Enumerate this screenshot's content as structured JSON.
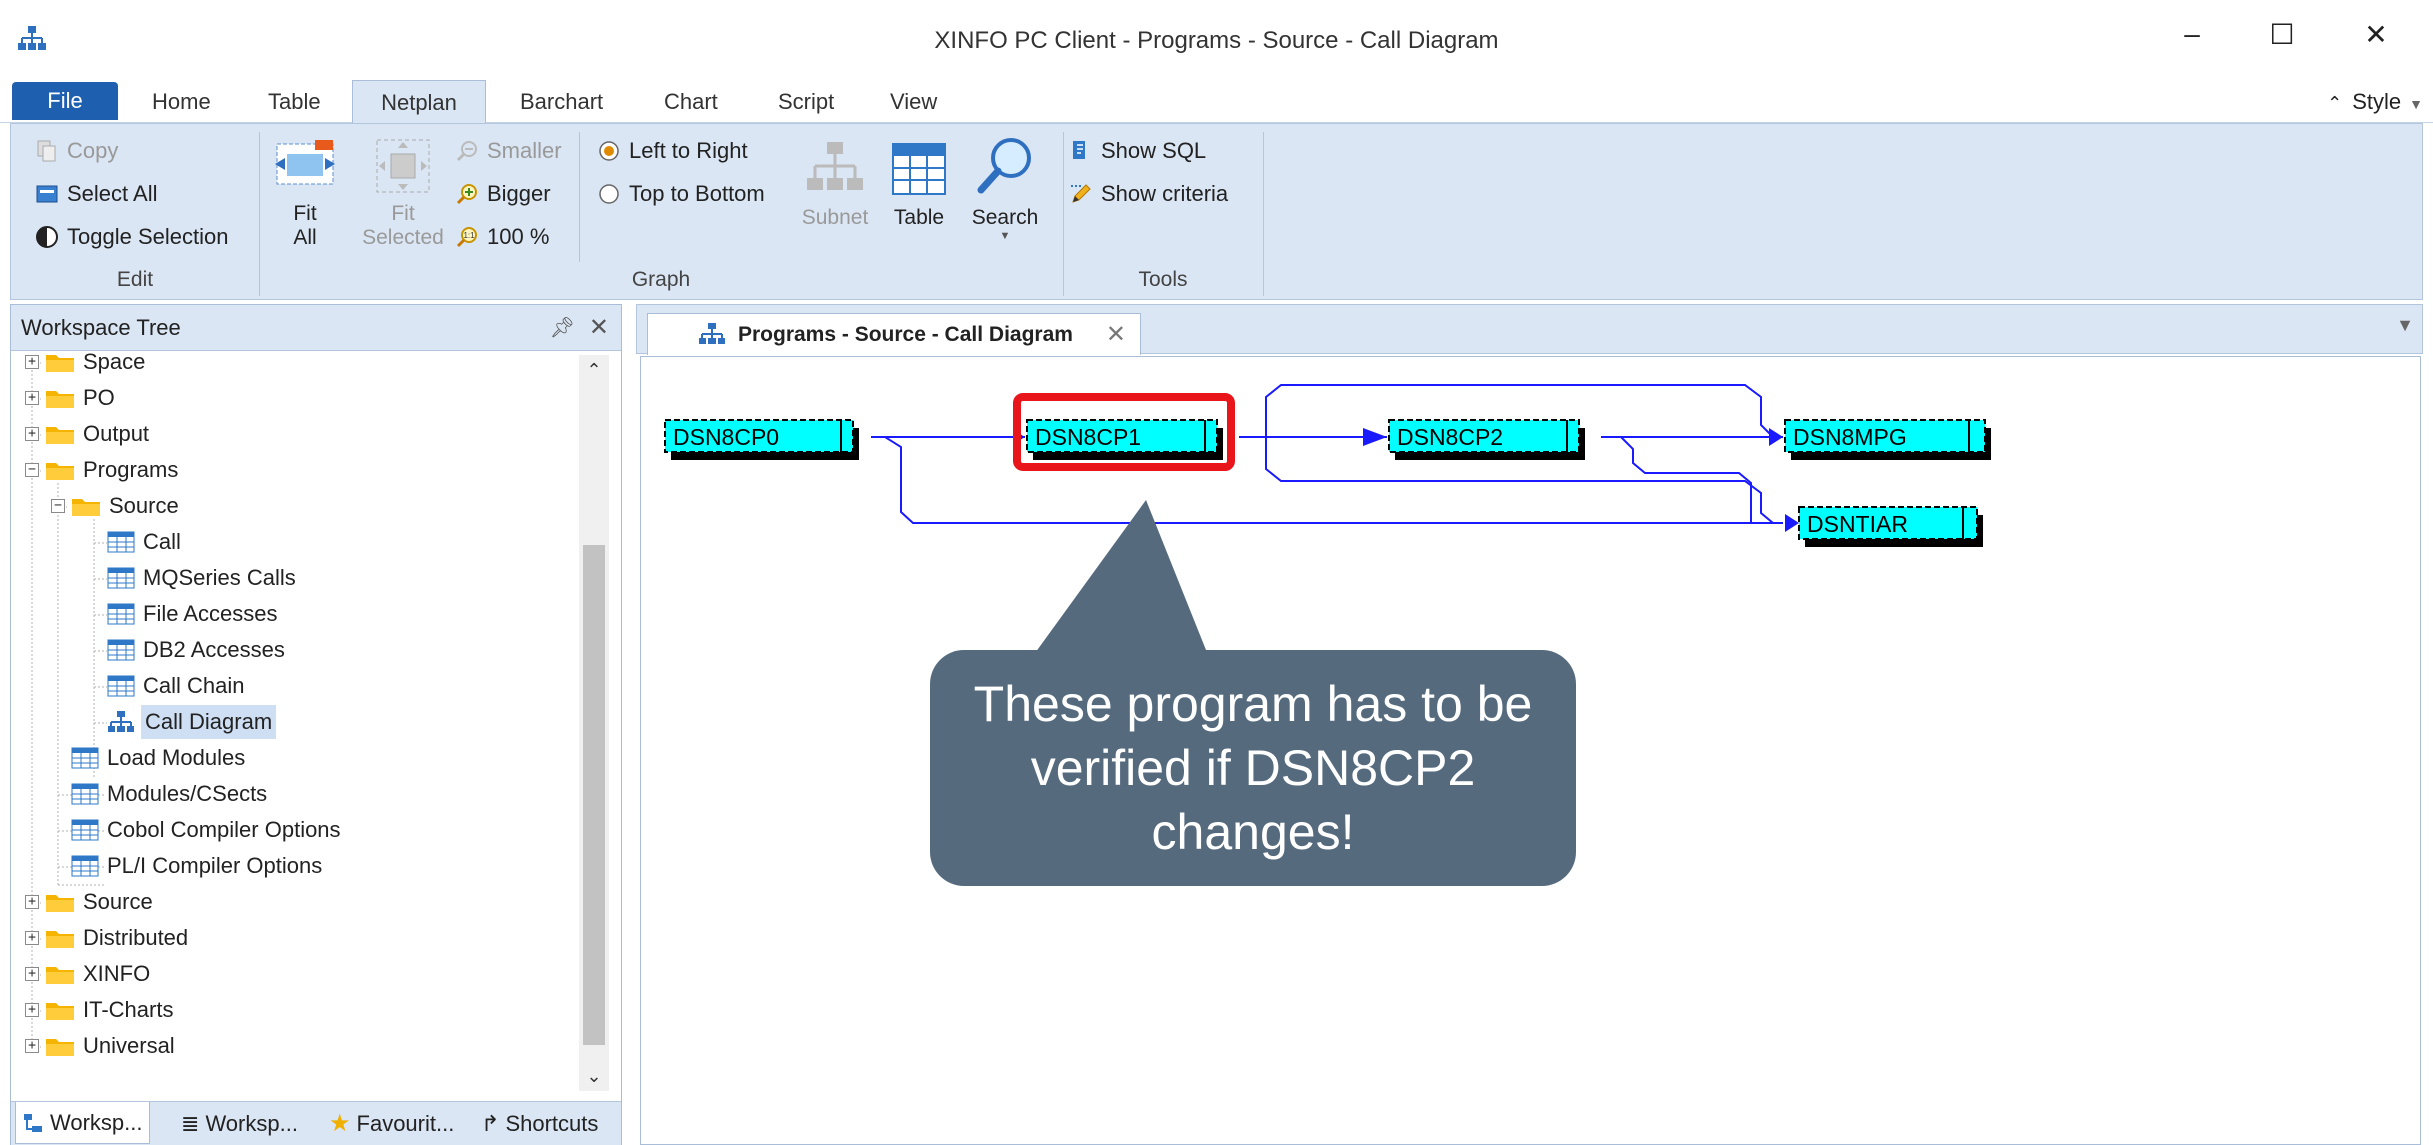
{
  "window": {
    "title": "XINFO PC Client - Programs - Source - Call Diagram",
    "minimize": "–",
    "maximize": "☐",
    "close": "✕"
  },
  "ribbon_tabs": [
    "File",
    "Home",
    "Table",
    "Netplan",
    "Barchart",
    "Chart",
    "Script",
    "View"
  ],
  "ribbon_active_tab": "Netplan",
  "style_label": "Style",
  "ribbon": {
    "edit": {
      "copy": "Copy",
      "select_all": "Select All",
      "toggle_selection": "Toggle Selection",
      "label": "Edit"
    },
    "graph": {
      "fit_all_1": "Fit",
      "fit_all_2": "All",
      "fit_selected_1": "Fit",
      "fit_selected_2": "Selected",
      "smaller": "Smaller",
      "bigger": "Bigger",
      "zoom": "100 %",
      "left_to_right": "Left to Right",
      "top_to_bottom": "Top to Bottom",
      "subnet": "Subnet",
      "table": "Table",
      "search": "Search",
      "label": "Graph"
    },
    "tools": {
      "show_sql": "Show SQL",
      "show_criteria": "Show criteria",
      "label": "Tools"
    }
  },
  "workspace": {
    "title": "Workspace Tree",
    "tree": [
      "Space",
      "PO",
      "Output",
      "Programs",
      "Source",
      "Call",
      "MQSeries Calls",
      "File Accesses",
      "DB2 Accesses",
      "Call Chain",
      "Call Diagram",
      "Load Modules",
      "Modules/CSects",
      "Cobol Compiler Options",
      "PL/I Compiler Options",
      "Source",
      "Distributed",
      "XINFO",
      "IT-Charts",
      "Universal"
    ],
    "bottom_tabs": [
      "Worksp...",
      "Worksp...",
      "Favourit...",
      "Shortcuts"
    ]
  },
  "document": {
    "tab_title": "Programs - Source - Call Diagram"
  },
  "diagram": {
    "nodes": [
      "DSN8CP0",
      "DSN8CP1",
      "DSN8CP2",
      "DSN8MPG",
      "DSNTIAR"
    ],
    "highlighted": "DSN8CP1",
    "node_color": "#00ffff",
    "edge_color": "#1a1aff",
    "highlight_color": "#e8161b"
  },
  "callout": {
    "text": "These program has to be verified if DSN8CP2 changes!"
  }
}
